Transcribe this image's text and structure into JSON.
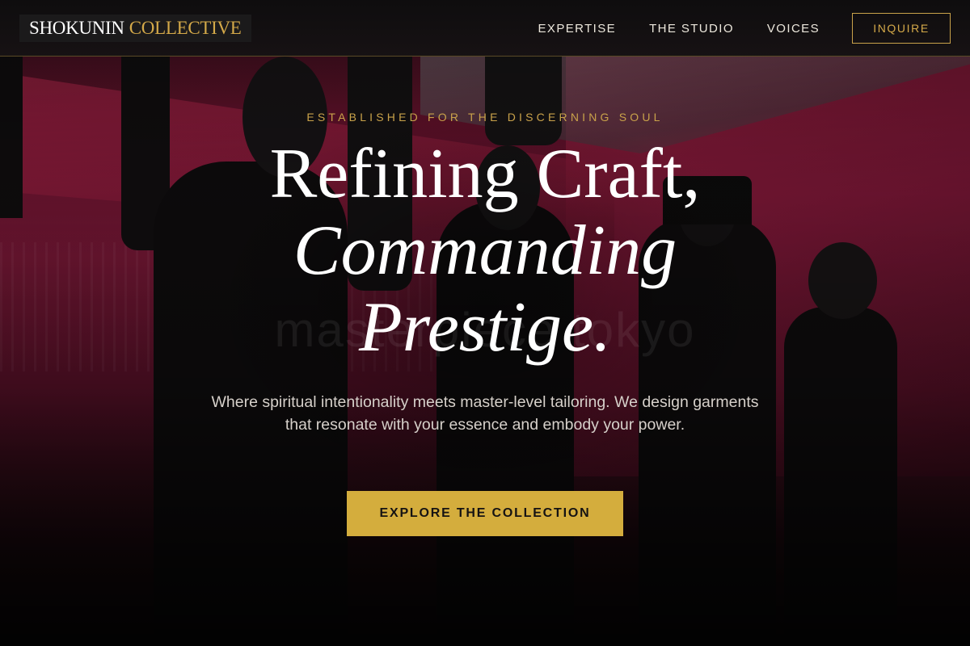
{
  "brand": {
    "name_primary": "SHOKUNIN",
    "name_secondary": "COLLECTIVE",
    "accent_color": "#d4a949"
  },
  "nav": {
    "items": [
      {
        "label": "EXPERTISE"
      },
      {
        "label": "THE STUDIO"
      },
      {
        "label": "VOICES"
      }
    ],
    "cta_label": "INQUIRE"
  },
  "hero": {
    "eyebrow": "ESTABLISHED FOR THE DISCERNING SOUL",
    "headline_line1": "Refining Craft,",
    "headline_line2": "Commanding",
    "headline_line3": "Prestige.",
    "watermark": "masterpiece tokyo",
    "lead": "Where spiritual intentionality meets master-level tailoring. We design garments that resonate with your essence and embody your power.",
    "cta_label": "EXPLORE THE COLLECTION",
    "cta_color": "#d4ad3d",
    "background_tint": "#6a1530"
  }
}
